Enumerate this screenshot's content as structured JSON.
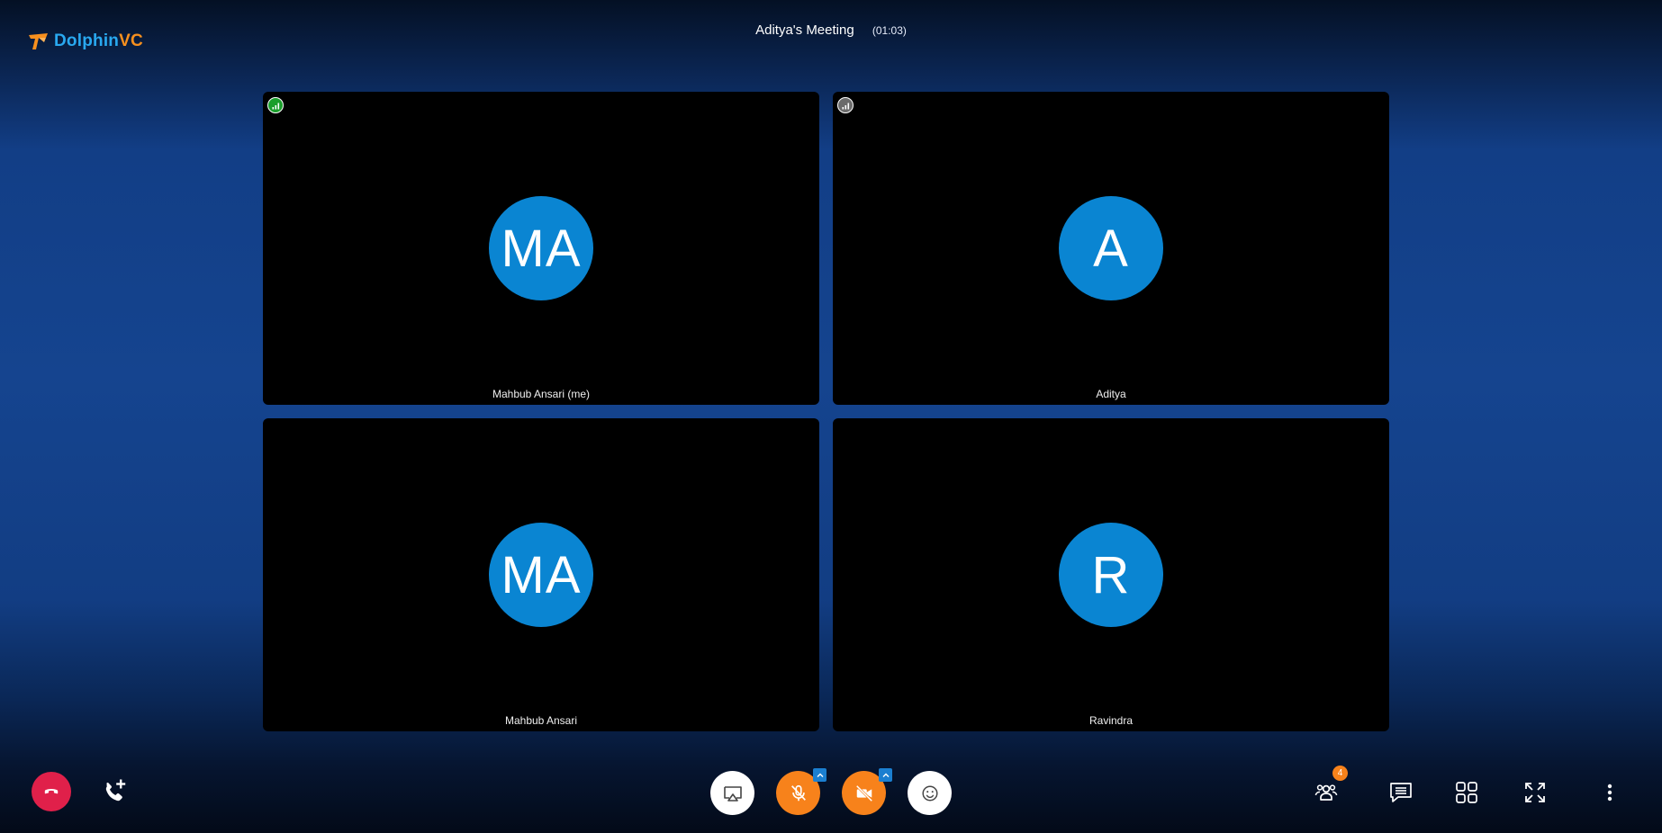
{
  "app": {
    "logo_part1": "Dolphin",
    "logo_part2": "VC",
    "brand_blue": "#29a9f0",
    "brand_orange": "#f7901e"
  },
  "meeting": {
    "title": "Aditya's Meeting",
    "elapsed": "(01:03)"
  },
  "participants": [
    {
      "initials": "MA",
      "name": "Mahbub Ansari (me)",
      "signal": "good"
    },
    {
      "initials": "A",
      "name": "Aditya",
      "signal": "neutral"
    },
    {
      "initials": "MA",
      "name": "Mahbub Ansari",
      "signal": "none"
    },
    {
      "initials": "R",
      "name": "Ravindra",
      "signal": "none"
    }
  ],
  "toolbar": {
    "left": [
      "end-call-icon",
      "add-call-icon"
    ],
    "center": [
      "screen-share-icon",
      "mic-off-icon",
      "video-off-icon",
      "emoji-icon"
    ],
    "right": [
      "participants-icon",
      "chat-icon",
      "layout-grid-icon",
      "fullscreen-icon",
      "more-vertical-icon"
    ],
    "participant_count": "4",
    "colors": {
      "hangup": "#e0204a",
      "muted": "#f7821b",
      "avatar": "#0a85d2",
      "chip": "#1b7fd0"
    }
  }
}
